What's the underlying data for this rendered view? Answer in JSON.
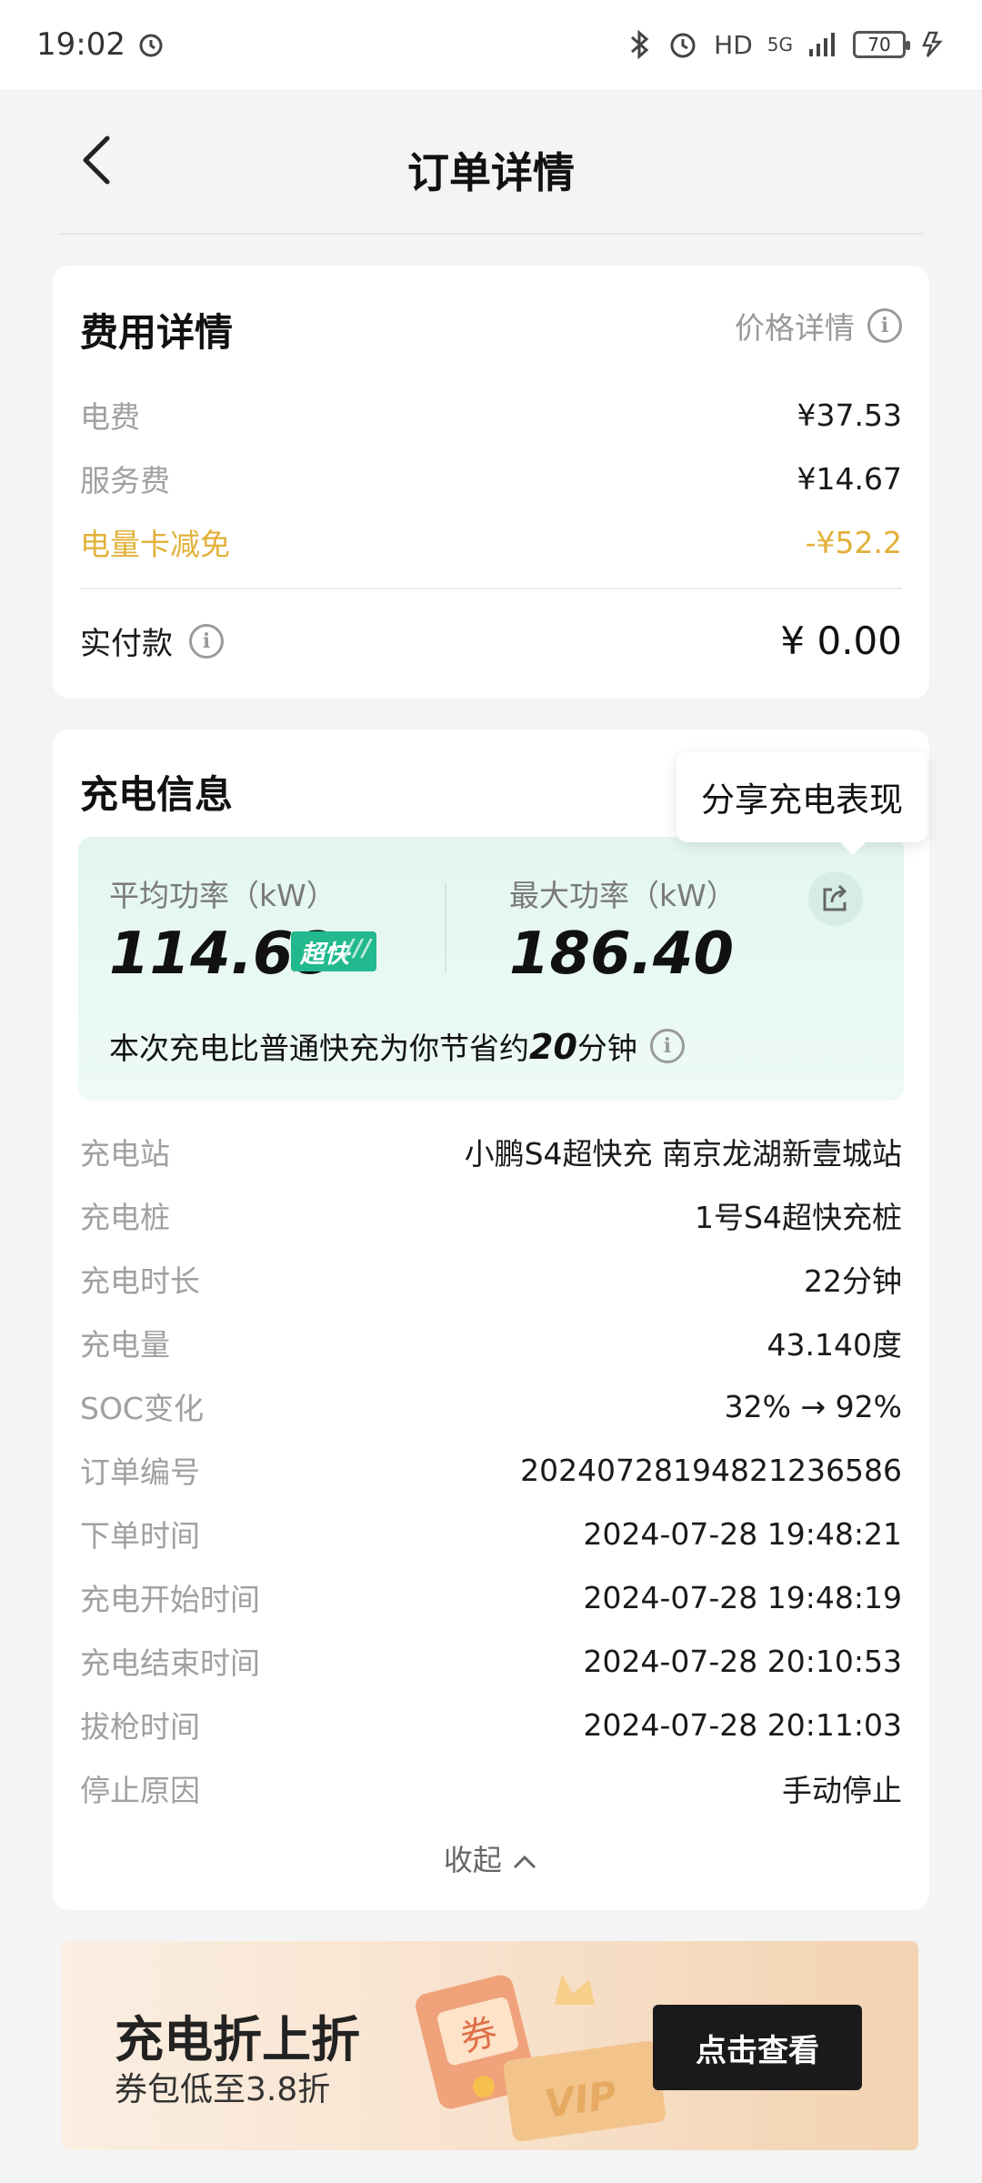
{
  "status_bar": {
    "time": "19:02",
    "network": "HD",
    "signal": "5G",
    "battery": "70"
  },
  "header": {
    "title": "订单详情"
  },
  "fee_card": {
    "title": "费用详情",
    "price_detail_link": "价格详情",
    "rows": [
      {
        "label": "电费",
        "value": "¥37.53"
      },
      {
        "label": "服务费",
        "value": "¥14.67"
      },
      {
        "label": "电量卡减免",
        "value": "-¥52.2"
      }
    ],
    "paid_label": "实付款",
    "paid_value": "¥ 0.00"
  },
  "charge_card": {
    "title": "充电信息",
    "avg_power_label": "平均功率（kW）",
    "avg_power_value": "114.68",
    "badge": "超快",
    "max_power_label": "最大功率（kW）",
    "max_power_value": "186.40",
    "save_prefix": "本次充电比普通快充为你节省约",
    "save_minutes": "20",
    "save_suffix": "分钟",
    "tooltip": "分享充电表现",
    "details": [
      {
        "label": "充电站",
        "value": "小鹏S4超快充 南京龙湖新壹城站"
      },
      {
        "label": "充电桩",
        "value": "1号S4超快充桩"
      },
      {
        "label": "充电时长",
        "value": "22分钟"
      },
      {
        "label": "充电量",
        "value": "43.140度"
      },
      {
        "label": "SOC变化",
        "value": "32% → 92%"
      },
      {
        "label": "订单编号",
        "value": "20240728194821236586"
      },
      {
        "label": "下单时间",
        "value": "2024-07-28 19:48:21"
      },
      {
        "label": "充电开始时间",
        "value": "2024-07-28 19:48:19"
      },
      {
        "label": "充电结束时间",
        "value": "2024-07-28 20:10:53"
      },
      {
        "label": "拔枪时间",
        "value": "2024-07-28 20:11:03"
      },
      {
        "label": "停止原因",
        "value": "手动停止"
      }
    ],
    "collapse_label": "收起"
  },
  "banner": {
    "title": "充电折上折",
    "subtitle": "券包低至3.8折",
    "coupon_text": "券",
    "vip_text": "VIP",
    "button": "点击查看"
  },
  "colors": {
    "accent_gold": "#e2b13a",
    "badge_green": "#21b98d",
    "stats_bg": "#e2f6ef"
  }
}
